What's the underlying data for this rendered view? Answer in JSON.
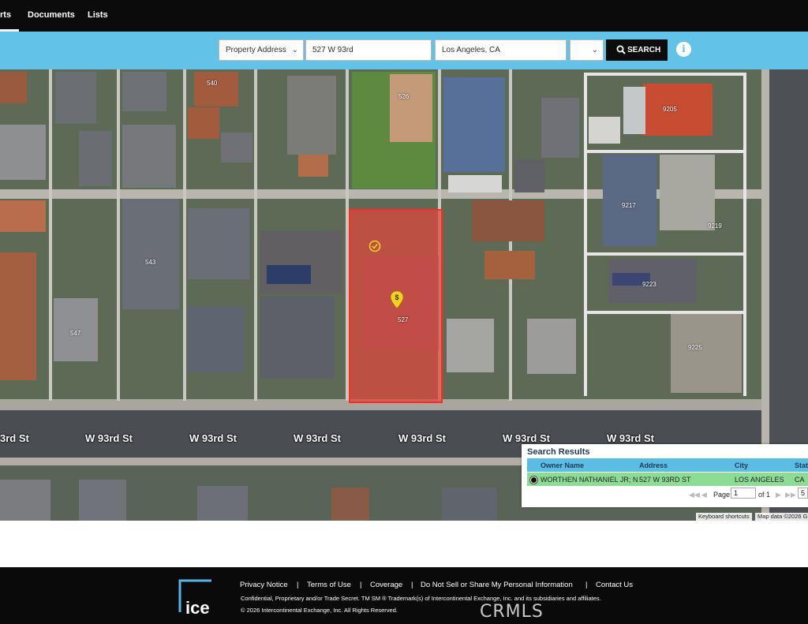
{
  "nav": {
    "tabs": [
      {
        "label": "rts"
      },
      {
        "label": "Documents"
      },
      {
        "label": "Lists"
      }
    ]
  },
  "search": {
    "type_value": "Property Address",
    "address_value": "527 W 93rd",
    "city_value": "Los Angeles, CA",
    "button_label": "SEARCH"
  },
  "map": {
    "streets": [
      "3rd St",
      "W 93rd St",
      "W 93rd St",
      "W 93rd St",
      "W 93rd St",
      "W 93rd St",
      "W 93rd St"
    ],
    "house_numbers": [
      "540",
      "526",
      "9205",
      "9217",
      "9219",
      "543",
      "527",
      "9223",
      "547",
      "9225"
    ],
    "attribution": {
      "shortcuts": "Keyboard shortcuts",
      "mapdata": "Map data ©2026 G"
    },
    "colors": {
      "parcel_fill": "#e0463c",
      "marker": "#f2d21f"
    }
  },
  "results": {
    "title": "Search Results",
    "columns": [
      "Owner Name",
      "Address",
      "City",
      "State"
    ],
    "rows": [
      {
        "owner": "WORTHEN NATHANIEL JR; NAT",
        "address": "527 W 93RD ST",
        "city": "LOS ANGELES",
        "state": "CA"
      }
    ],
    "pager": {
      "page_label": "Page",
      "page_value": "1",
      "of_label": "of 1",
      "size_value": "5"
    }
  },
  "footer": {
    "links": [
      "Privacy Notice",
      "Terms of Use",
      "Coverage",
      "Do Not Sell or Share My Personal Information",
      "Contact Us"
    ],
    "separator": "|",
    "legal1": "Confidential, Proprietary and/or Trade Secret. TM SM ® Trademark(s) of Intercontinental Exchange, Inc. and its subsidiaries and affiliates.",
    "legal2": "© 2026 Intercontinental Exchange, Inc. All Rights Reserved.",
    "logo_text": "ice",
    "watermark": "CRMLS"
  }
}
